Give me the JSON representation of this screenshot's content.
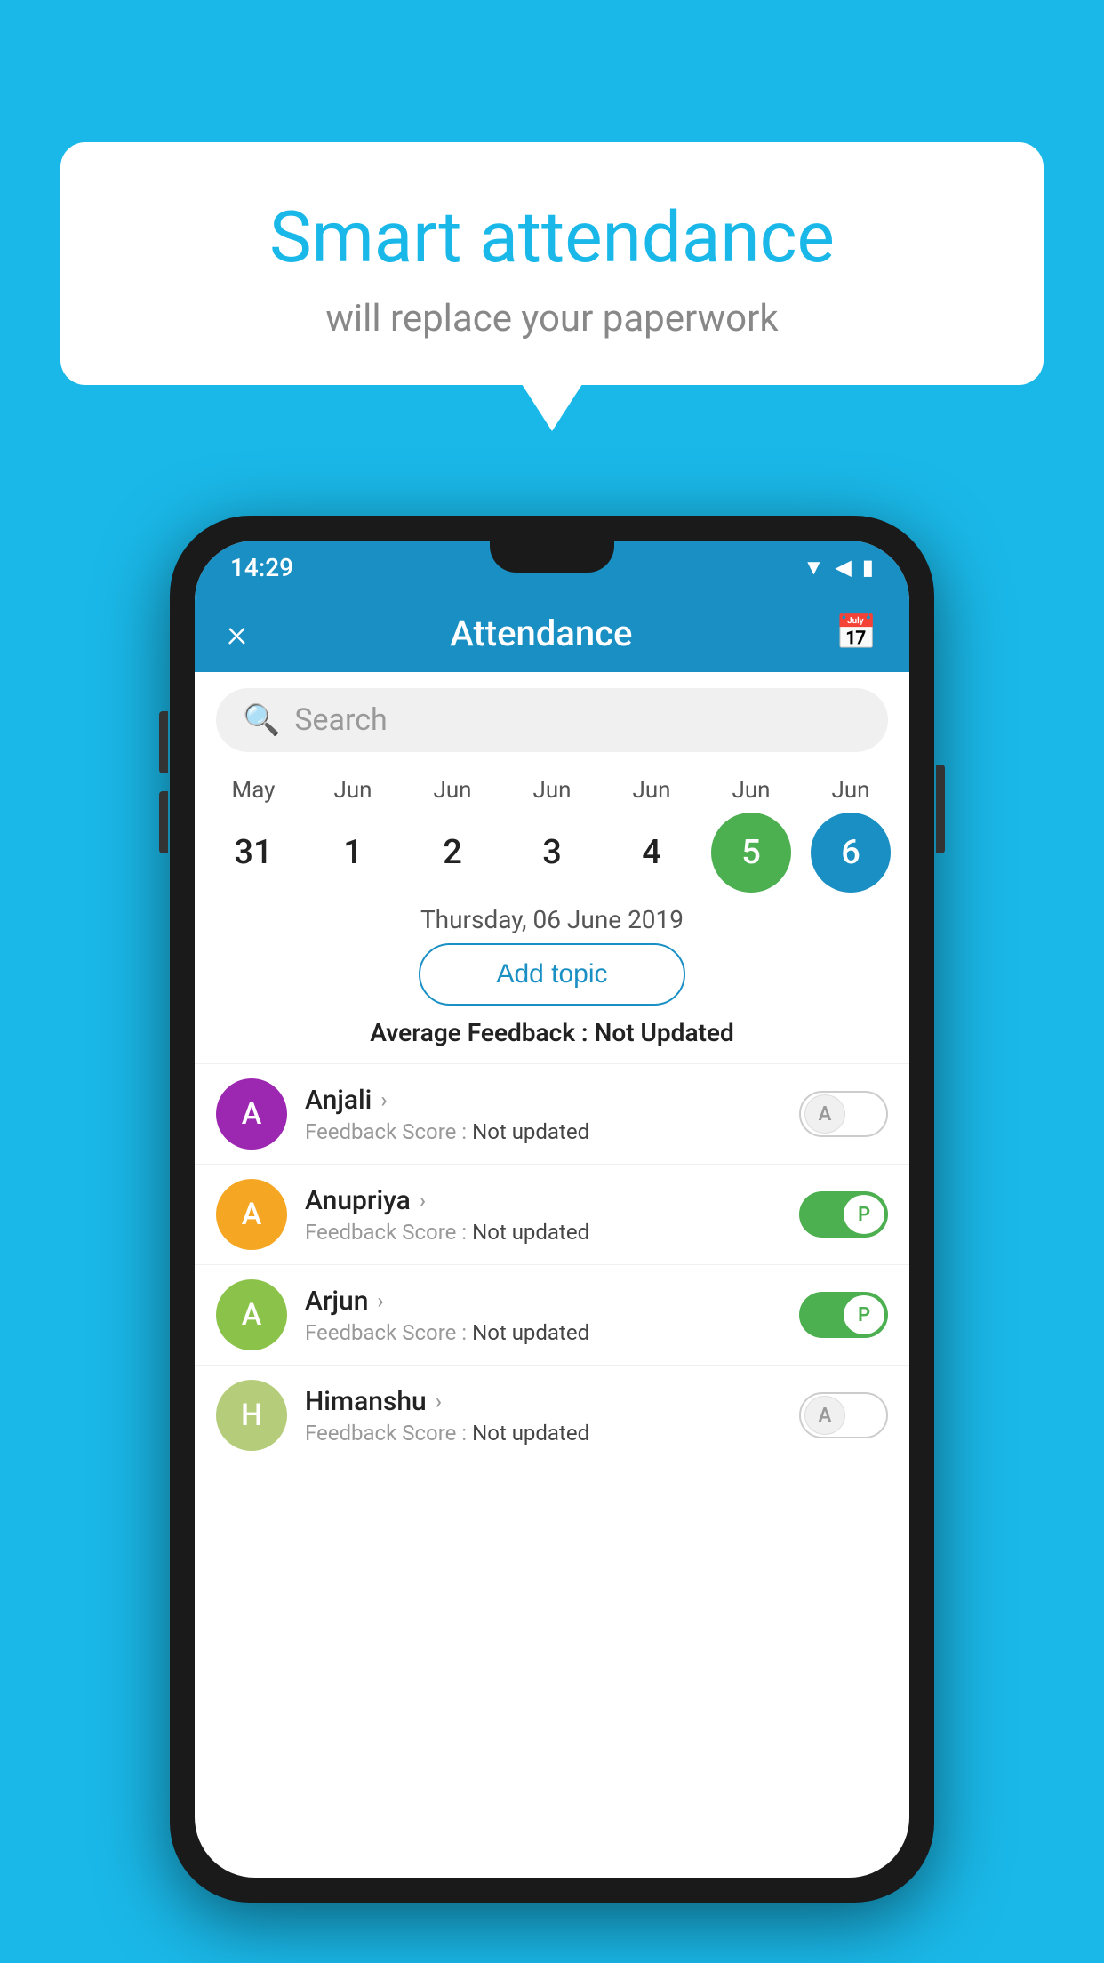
{
  "background": {
    "color": "#1ab8e8"
  },
  "speech_bubble": {
    "title": "Smart attendance",
    "subtitle": "will replace your paperwork"
  },
  "status_bar": {
    "time": "14:29"
  },
  "app_header": {
    "title": "Attendance",
    "close_label": "×",
    "calendar_icon": "📅"
  },
  "search": {
    "placeholder": "Search"
  },
  "dates": [
    {
      "month": "May",
      "day": "31",
      "style": "normal"
    },
    {
      "month": "Jun",
      "day": "1",
      "style": "normal"
    },
    {
      "month": "Jun",
      "day": "2",
      "style": "normal"
    },
    {
      "month": "Jun",
      "day": "3",
      "style": "normal"
    },
    {
      "month": "Jun",
      "day": "4",
      "style": "normal"
    },
    {
      "month": "Jun",
      "day": "5",
      "style": "green"
    },
    {
      "month": "Jun",
      "day": "6",
      "style": "blue"
    }
  ],
  "selected_date": "Thursday, 06 June 2019",
  "add_topic_label": "Add topic",
  "avg_feedback_label": "Average Feedback :",
  "avg_feedback_value": "Not Updated",
  "students": [
    {
      "name": "Anjali",
      "avatar_letter": "A",
      "avatar_color": "#9c27b0",
      "feedback_label": "Feedback Score :",
      "feedback_value": "Not updated",
      "toggle": "off",
      "toggle_letter": "A"
    },
    {
      "name": "Anupriya",
      "avatar_letter": "A",
      "avatar_color": "#f5a623",
      "feedback_label": "Feedback Score :",
      "feedback_value": "Not updated",
      "toggle": "on",
      "toggle_letter": "P"
    },
    {
      "name": "Arjun",
      "avatar_letter": "A",
      "avatar_color": "#8bc34a",
      "feedback_label": "Feedback Score :",
      "feedback_value": "Not updated",
      "toggle": "on",
      "toggle_letter": "P"
    },
    {
      "name": "Himanshu",
      "avatar_letter": "H",
      "avatar_color": "#b5cc7a",
      "feedback_label": "Feedback Score :",
      "feedback_value": "Not updated",
      "toggle": "off",
      "toggle_letter": "A"
    }
  ]
}
